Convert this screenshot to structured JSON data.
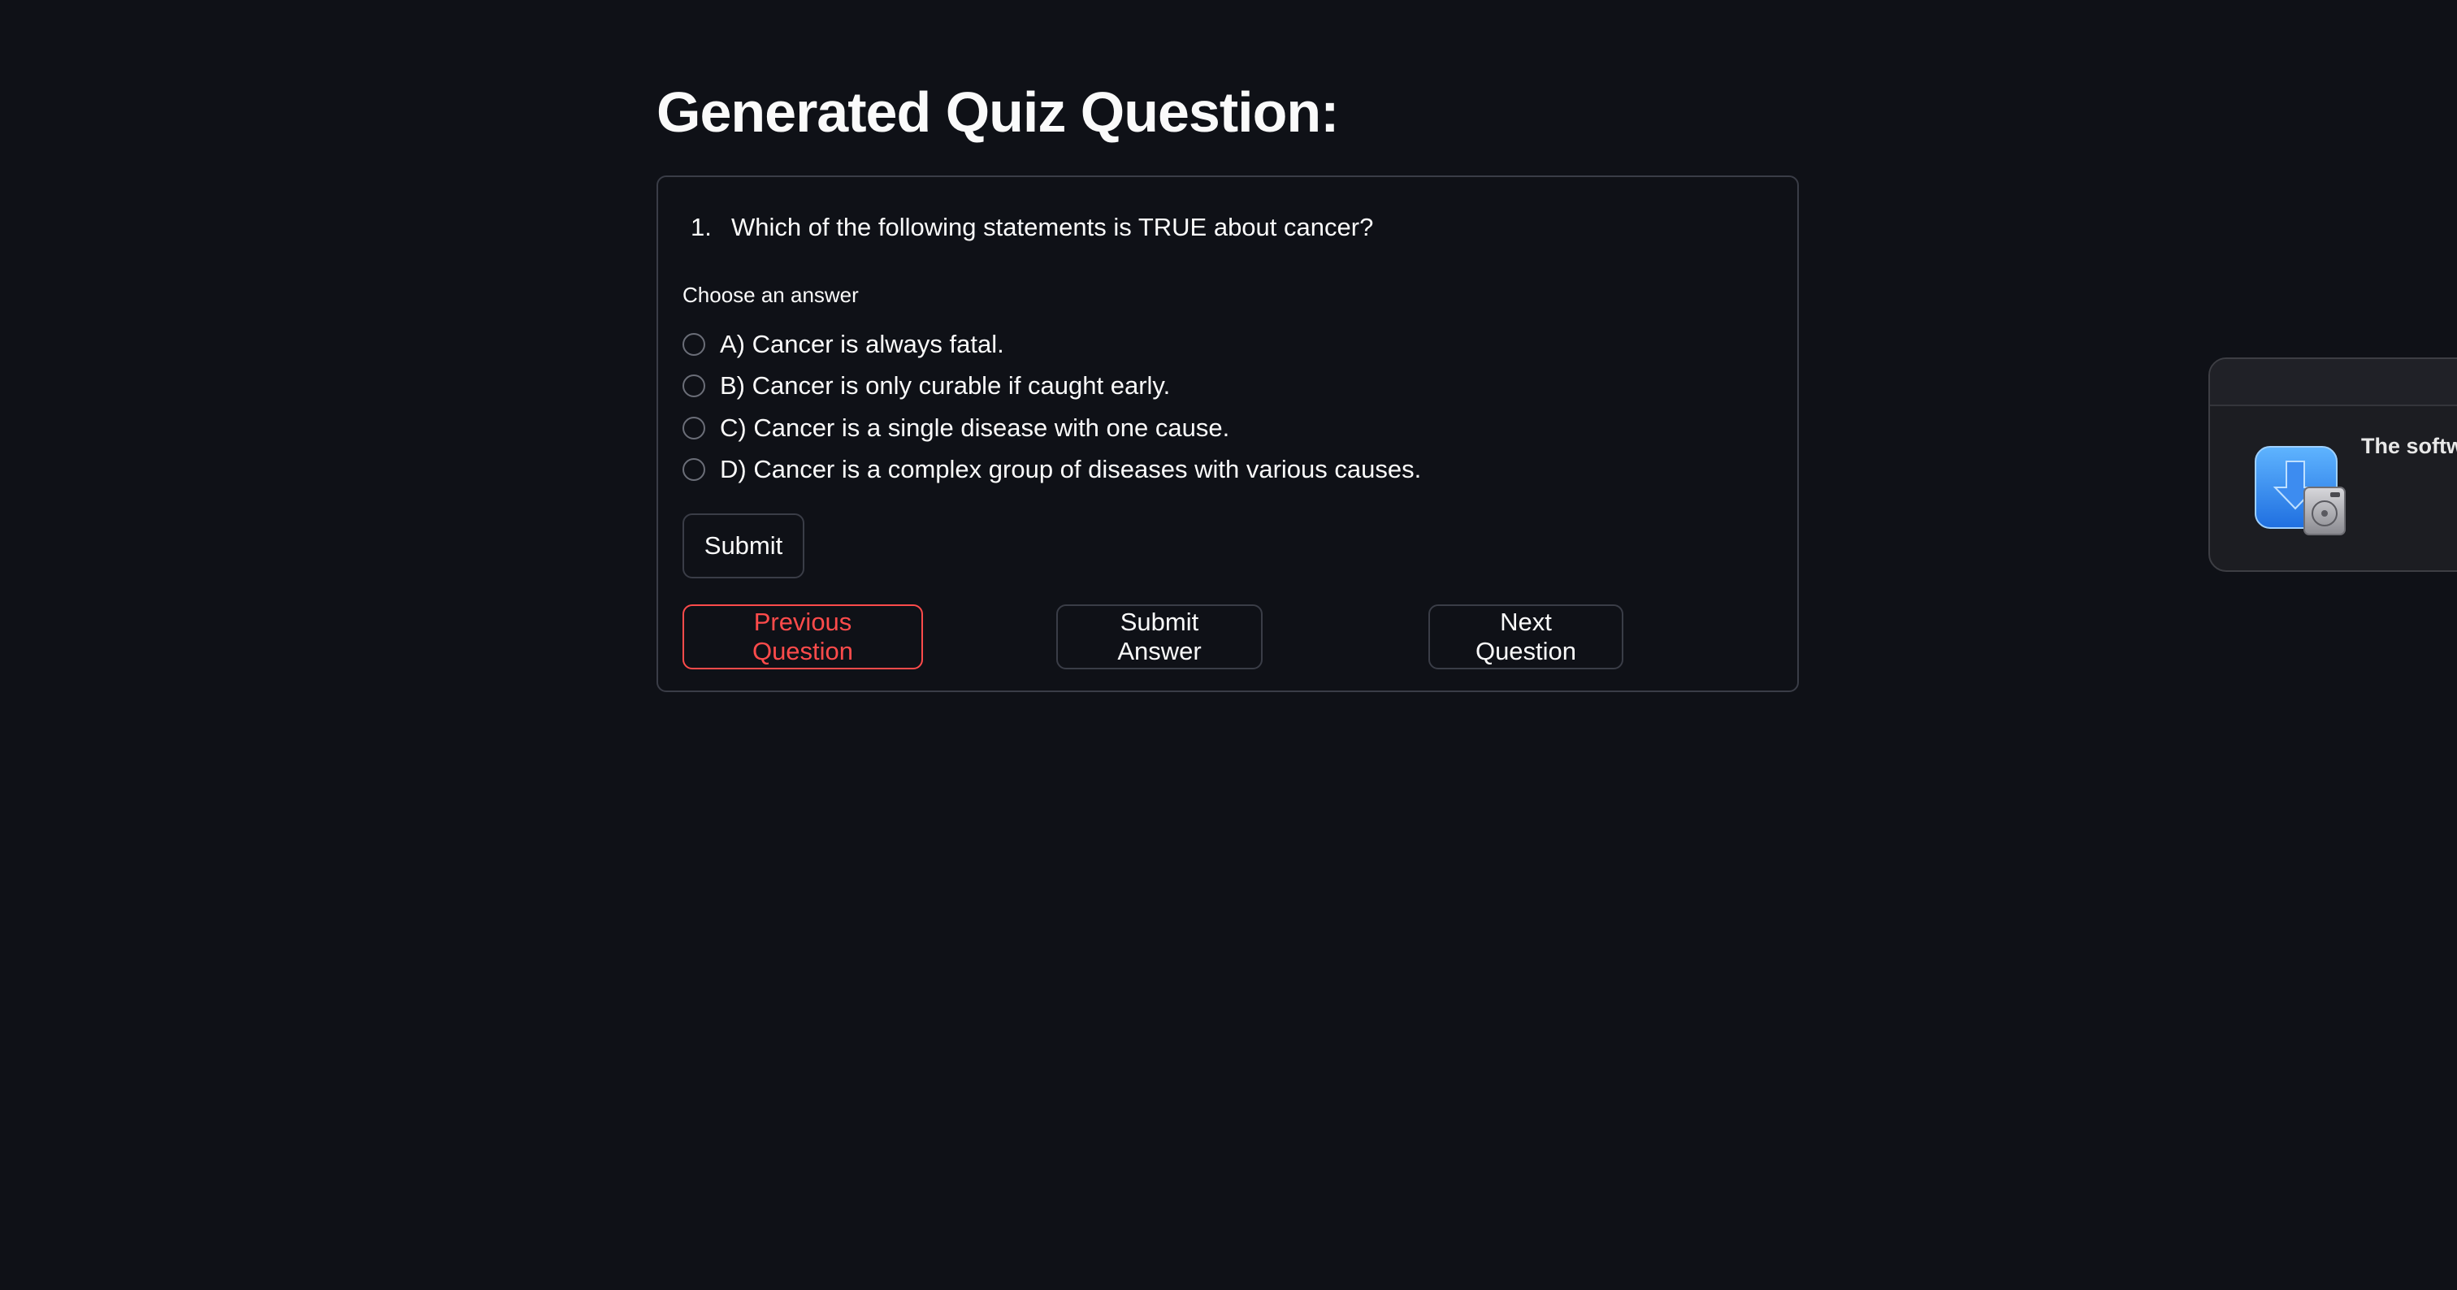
{
  "page": {
    "title": "Generated Quiz Question:"
  },
  "question": {
    "number": "1.",
    "text": "Which of the following statements is TRUE about cancer?"
  },
  "answer_group": {
    "label": "Choose an answer",
    "options": [
      {
        "label": "A) Cancer is always fatal.",
        "selected": false
      },
      {
        "label": "B) Cancer is only curable if caught early.",
        "selected": false
      },
      {
        "label": "C) Cancer is a single disease with one cause.",
        "selected": false
      },
      {
        "label": "D) Cancer is a complex group of diseases with various causes.",
        "selected": false
      }
    ]
  },
  "buttons": {
    "submit": "Submit",
    "previous": "Previous Question",
    "submit_answer": "Submit Answer",
    "next": "Next Question"
  },
  "notification": {
    "icon": "software-update-installer-icon",
    "text": "The softw"
  },
  "colors": {
    "background": "#0f1117",
    "text": "#fafafa",
    "border": "#3a3d47",
    "accent_red": "#ff4b4b"
  }
}
